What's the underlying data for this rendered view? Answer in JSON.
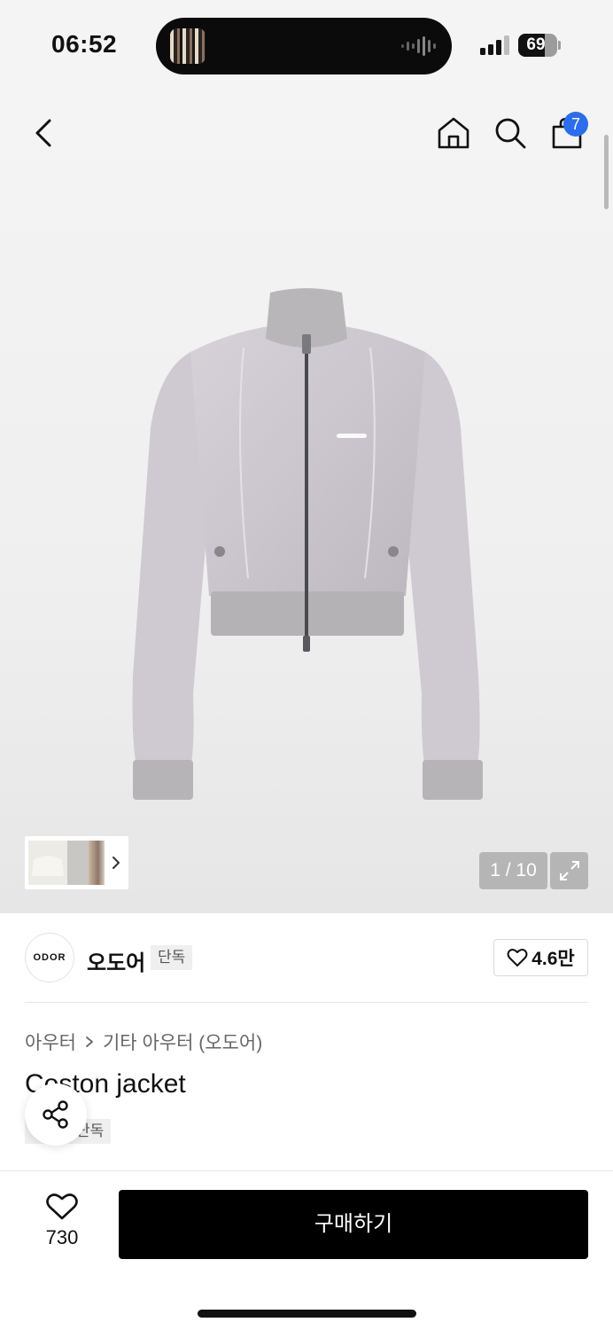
{
  "status_bar": {
    "time": "06:52",
    "battery_percent": 69,
    "battery_text": "69",
    "signal_bars": 3
  },
  "nav": {
    "icons": [
      "back-icon",
      "home-icon",
      "search-icon",
      "cart-icon"
    ],
    "cart_badge": "7",
    "badge_color": "#2a6df0"
  },
  "gallery": {
    "logo_on_jacket": "ODOR",
    "page_counter": "1 / 10",
    "expand_icon": "expand-icon"
  },
  "brand": {
    "logo_text": "ODOR",
    "name": "오도어",
    "tag": "단독",
    "likes": "4.6만"
  },
  "product": {
    "breadcrumb": [
      "아우터",
      "기타 아우터 (오도어)"
    ],
    "title": "Coston jacket",
    "tag": "단독"
  },
  "bottom_bar": {
    "wish_count": "730",
    "buy_label": "구매하기",
    "buy_color": "#000000"
  }
}
